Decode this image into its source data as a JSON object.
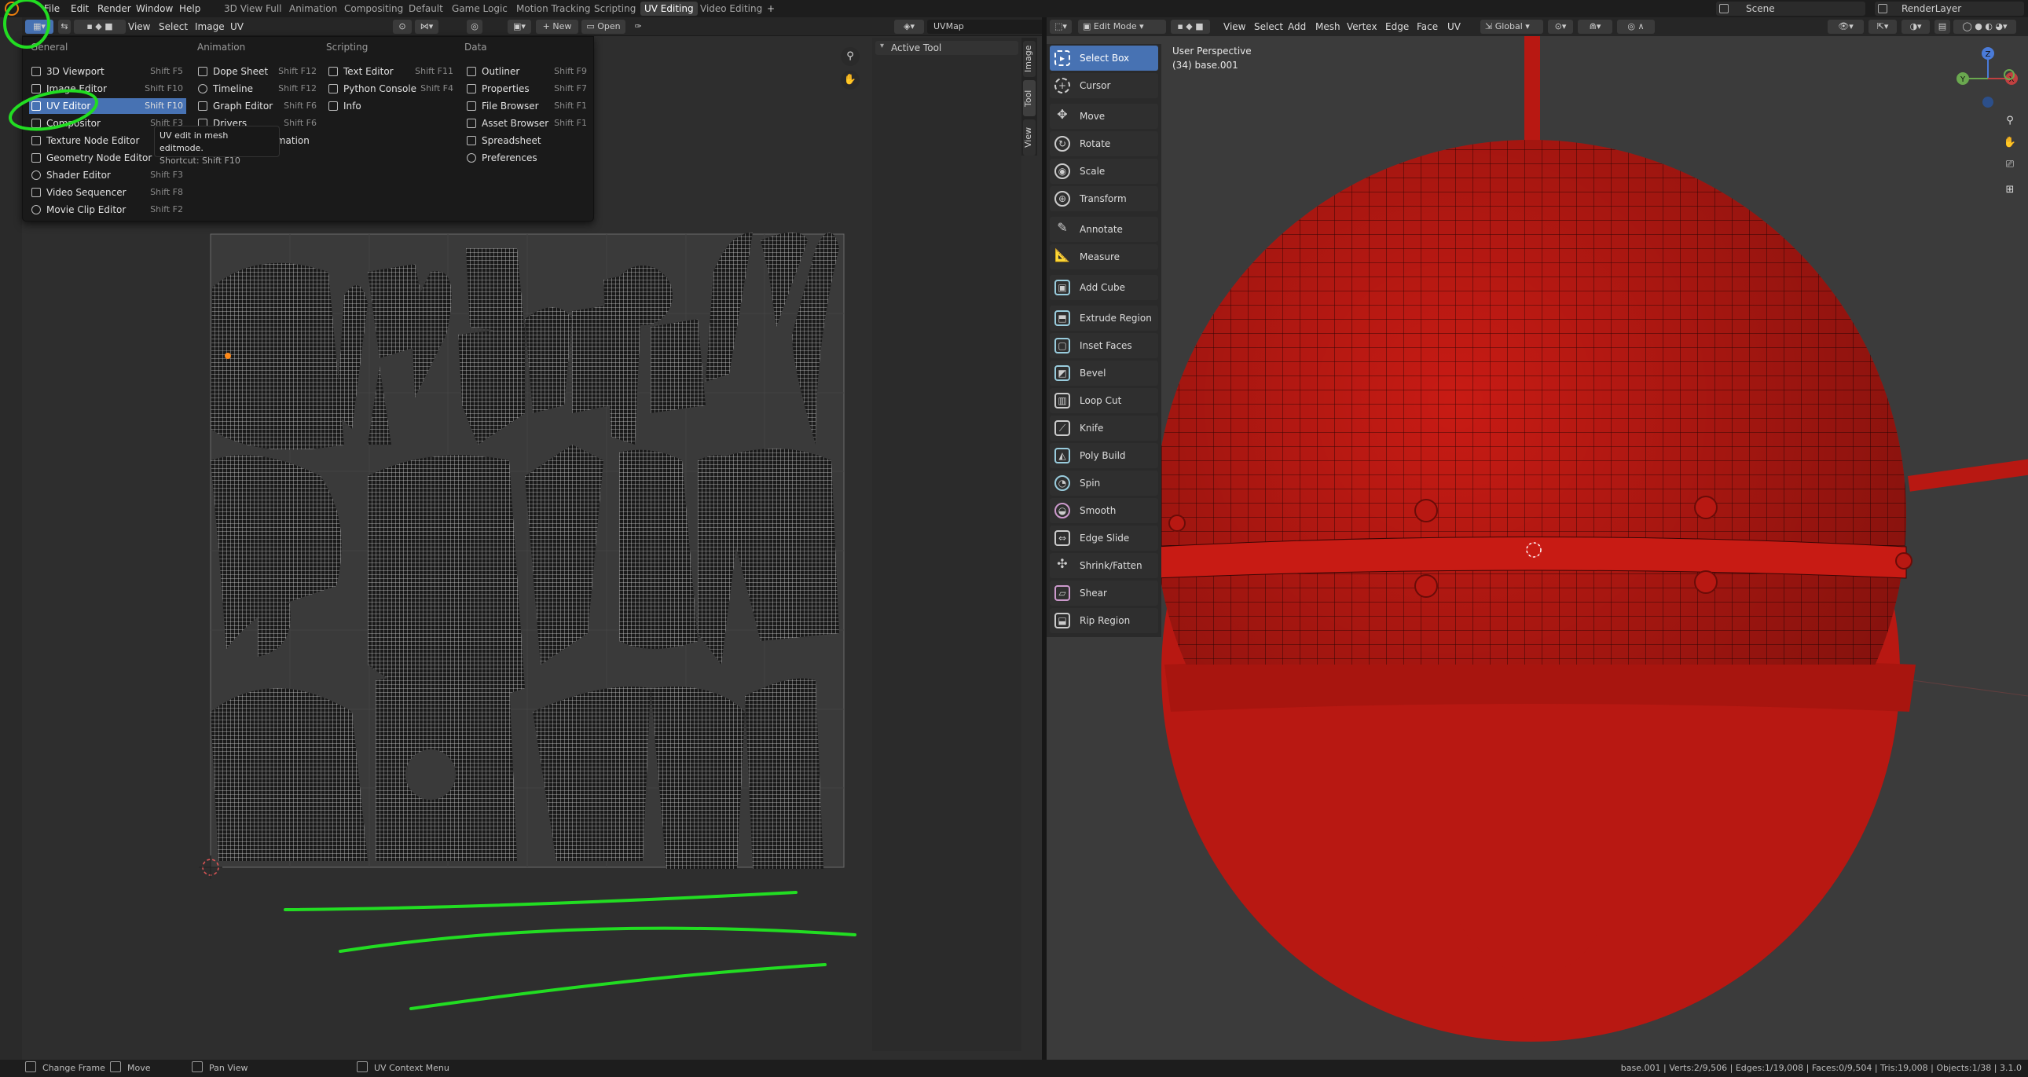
{
  "topbar": {
    "menus": [
      "File",
      "Edit",
      "Render",
      "Window",
      "Help"
    ],
    "workspaces": [
      "3D View Full",
      "Animation",
      "Compositing",
      "Default",
      "Game Logic",
      "Motion Tracking",
      "Scripting",
      "UV Editing",
      "Video Editing"
    ],
    "active_workspace": "UV Editing",
    "add_tab": "+",
    "scene": "Scene",
    "render_layer": "RenderLayer"
  },
  "uv_header": {
    "menus": [
      "View",
      "Select",
      "Image",
      "UV"
    ],
    "new_label": "New",
    "open_label": "Open",
    "uvmap_name": "UVMap"
  },
  "dropdown": {
    "columns": [
      "General",
      "Animation",
      "Scripting",
      "Data"
    ],
    "general": [
      {
        "label": "3D Viewport",
        "shortcut": "Shift F5"
      },
      {
        "label": "Image Editor",
        "shortcut": "Shift F10"
      },
      {
        "label": "UV Editor",
        "shortcut": "Shift F10"
      },
      {
        "label": "Compositor",
        "shortcut": "Shift F3"
      },
      {
        "label": "Texture Node Editor",
        "shortcut": ""
      },
      {
        "label": "Geometry Node Editor",
        "shortcut": ""
      },
      {
        "label": "Shader Editor",
        "shortcut": "Shift F3"
      },
      {
        "label": "Video Sequencer",
        "shortcut": "Shift F8"
      },
      {
        "label": "Movie Clip Editor",
        "shortcut": "Shift F2"
      }
    ],
    "animation": [
      {
        "label": "Dope Sheet",
        "shortcut": "Shift F12"
      },
      {
        "label": "Timeline",
        "shortcut": "Shift F12"
      },
      {
        "label": "Graph Editor",
        "shortcut": "Shift F6"
      },
      {
        "label": "Drivers",
        "shortcut": "Shift F6"
      },
      {
        "label": "Nonlinear Animation",
        "shortcut": ""
      }
    ],
    "scripting": [
      {
        "label": "Text Editor",
        "shortcut": "Shift F11"
      },
      {
        "label": "Python Console",
        "shortcut": "Shift F4"
      },
      {
        "label": "Info",
        "shortcut": ""
      }
    ],
    "data": [
      {
        "label": "Outliner",
        "shortcut": "Shift F9"
      },
      {
        "label": "Properties",
        "shortcut": "Shift F7"
      },
      {
        "label": "File Browser",
        "shortcut": "Shift F1"
      },
      {
        "label": "Asset Browser",
        "shortcut": "Shift F1"
      },
      {
        "label": "Spreadsheet",
        "shortcut": ""
      },
      {
        "label": "Preferences",
        "shortcut": ""
      }
    ],
    "tooltip_line1": "UV edit in mesh editmode.",
    "tooltip_line2": "Shortcut: Shift F10"
  },
  "sidebar": {
    "panel_title": "Active Tool",
    "tabs": [
      "Image",
      "Tool",
      "View"
    ]
  },
  "viewport": {
    "mode": "Edit Mode",
    "menus": [
      "View",
      "Select",
      "Add",
      "Mesh",
      "Vertex",
      "Edge",
      "Face",
      "UV"
    ],
    "orientation": "Global",
    "title": "User Perspective",
    "object": "(34) base.001",
    "tools": [
      "Select Box",
      "Cursor",
      "Move",
      "Rotate",
      "Scale",
      "Transform",
      "Annotate",
      "Measure",
      "Add Cube",
      "Extrude Region",
      "Inset Faces",
      "Bevel",
      "Loop Cut",
      "Knife",
      "Poly Build",
      "Spin",
      "Smooth",
      "Edge Slide",
      "Shrink/Fatten",
      "Shear",
      "Rip Region"
    ],
    "active_tool": "Select Box",
    "gizmo_axes": [
      "Z",
      "Y",
      "X"
    ]
  },
  "statusbar": {
    "change_frame": "Change Frame",
    "move": "Move",
    "pan_view": "Pan View",
    "context_menu": "UV Context Menu",
    "stats": "base.001 | Verts:2/9,506 | Edges:1/19,008 | Faces:0/9,504 | Tris:19,008 | Objects:1/38 | 3.1.0"
  },
  "colors": {
    "accent": "#4772b3",
    "sphere": "#c81b14",
    "annotation": "#22dd22"
  }
}
